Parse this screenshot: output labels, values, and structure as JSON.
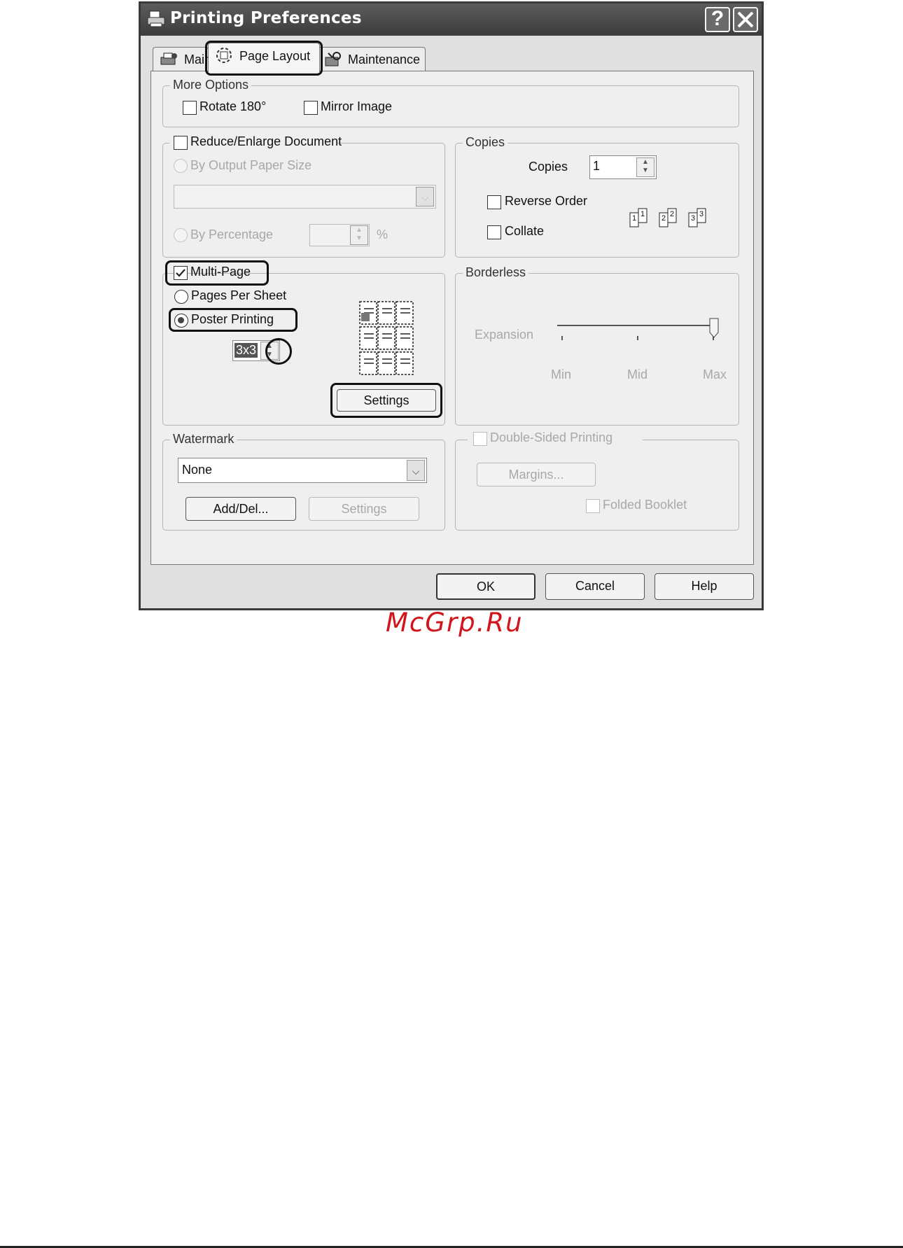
{
  "window": {
    "title": "Printing Preferences",
    "help_glyph": "?",
    "close_glyph": "✕"
  },
  "tabs": [
    {
      "label": "Main",
      "icon": "printer-tab-icon"
    },
    {
      "label": "Page Layout",
      "icon": "layout-tab-icon",
      "active": true
    },
    {
      "label": "Maintenance",
      "icon": "maintenance-tab-icon"
    }
  ],
  "more_options": {
    "title": "More Options",
    "rotate": "Rotate 180°",
    "mirror": "Mirror Image"
  },
  "reduce": {
    "checkbox": "Reduce/Enlarge Document",
    "by_output": "By Output Paper Size",
    "by_percentage": "By Percentage",
    "percent_sign": "%"
  },
  "copies": {
    "title": "Copies",
    "label": "Copies",
    "value": "1",
    "reverse": "Reverse Order",
    "collate": "Collate",
    "sheet_nums": [
      "1",
      "1",
      "2",
      "2",
      "3",
      "3"
    ]
  },
  "multipage": {
    "checkbox": "Multi-Page",
    "pages_per_sheet": "Pages Per Sheet",
    "poster": "Poster Printing",
    "poster_value": "3x3",
    "settings": "Settings"
  },
  "borderless": {
    "title": "Borderless",
    "expansion": "Expansion",
    "min": "Min",
    "mid": "Mid",
    "max": "Max"
  },
  "watermark": {
    "title": "Watermark",
    "selected": "None",
    "add_del": "Add/Del...",
    "settings": "Settings"
  },
  "double_sided": {
    "checkbox": "Double-Sided Printing",
    "margins": "Margins...",
    "folded": "Folded Booklet"
  },
  "footer": {
    "ok": "OK",
    "cancel": "Cancel",
    "help": "Help"
  },
  "site_watermark": "McGrp.Ru",
  "colors": {
    "title_bar": "#4a4a4a",
    "dialog": "#e0e0e0",
    "panel": "#efefef",
    "site_mark": "#d3141a"
  }
}
